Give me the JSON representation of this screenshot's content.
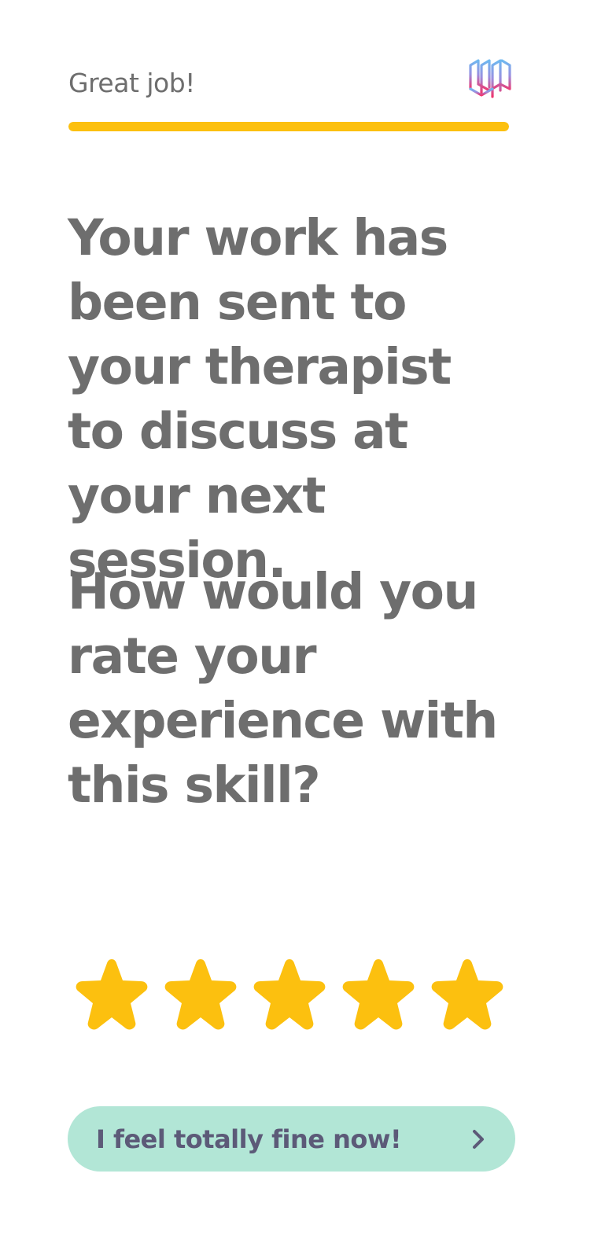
{
  "header": {
    "label": "Great job!",
    "logo_icon": "brand-logo-icon",
    "progress_fraction": 1.0,
    "progress_color": "#fcc00f"
  },
  "content": {
    "message": "Your work has been sent to your therapist to discuss at your next session.",
    "question": "How would you rate your experience with this skill?"
  },
  "rating": {
    "value": 5,
    "max": 5,
    "star_icon": "star-icon",
    "star_color": "#fcc00f"
  },
  "continue_button": {
    "label": "I feel totally fine now!",
    "icon": "chevron-right-icon",
    "background": "#b2e6d6",
    "text_color": "#5c5a78"
  }
}
